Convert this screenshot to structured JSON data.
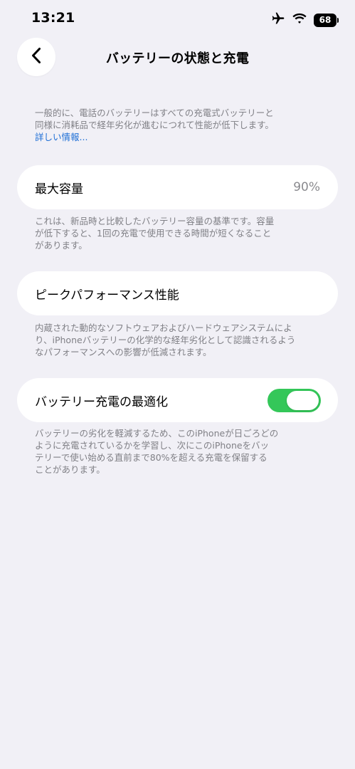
{
  "status_bar": {
    "time": "13:21",
    "battery_level": "68",
    "icons": [
      "airplane-icon",
      "wifi-icon",
      "battery-icon"
    ]
  },
  "nav": {
    "title": "バッテリーの状態と充電",
    "back_icon": "chevron-left-icon"
  },
  "intro": {
    "line1": "一般的に、電話のバッテリーはすべての充電式バッテリーと",
    "line2": "同様に消耗品で経年劣化が進むにつれて性能が低下します。",
    "link_label": "詳しい情報..."
  },
  "max_capacity": {
    "label": "最大容量",
    "value": "90%",
    "note_line1": "これは、新品時と比較したバッテリー容量の基準です。容量",
    "note_line2": "が低下すると、1回の充電で使用できる時間が短くなること",
    "note_line3": "があります。"
  },
  "peak_performance": {
    "label": "ピークパフォーマンス性能",
    "note_line1": "内蔵された動的なソフトウェアおよびハードウェアシステムによ",
    "note_line2": "り、iPhoneバッテリーの化学的な経年劣化として認識されるよう",
    "note_line3": "なパフォーマンスへの影響が低減されます。"
  },
  "optimized_charging": {
    "label": "バッテリー充電の最適化",
    "enabled": true,
    "toggle_color": "#34c759",
    "note_line1": "バッテリーの劣化を軽減するため、このiPhoneが日ごろどの",
    "note_line2": "ように充電されているかを学習し、次にこのiPhoneをバッ",
    "note_line3": "テリーで使い始める直前まで80%を超える充電を保留する",
    "note_line4": "ことがあります。"
  },
  "colors": {
    "background": "#f1f0f6",
    "card": "#ffffff",
    "secondary_text": "#808086",
    "link": "#1f6fd6",
    "accent_green": "#34c759"
  }
}
